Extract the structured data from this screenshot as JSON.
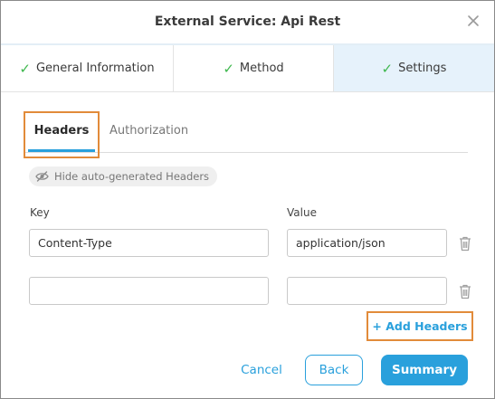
{
  "dialog": {
    "title": "External Service: Api Rest"
  },
  "steps": [
    {
      "label": "General Information",
      "state": "completed"
    },
    {
      "label": "Method",
      "state": "completed"
    },
    {
      "label": "Settings",
      "state": "active"
    }
  ],
  "tabs": [
    {
      "label": "Headers",
      "selected": true
    },
    {
      "label": "Authorization",
      "selected": false
    }
  ],
  "toggle": {
    "label": "Hide auto-generated Headers",
    "icon": "eye-slash-icon"
  },
  "columns": {
    "key": "Key",
    "value": "Value"
  },
  "rows": [
    {
      "key": "Content-Type",
      "value": "application/json"
    },
    {
      "key": "",
      "value": ""
    }
  ],
  "actions": {
    "add_headers": "+ Add Headers",
    "cancel": "Cancel",
    "back": "Back",
    "summary": "Summary"
  },
  "colors": {
    "accent": "#29a0dc",
    "check": "#3fb84e",
    "highlight": "#e28b3a",
    "active_step_bg": "#e6f2fb"
  }
}
